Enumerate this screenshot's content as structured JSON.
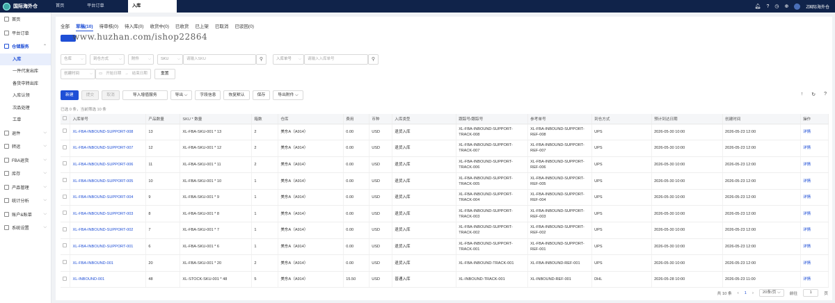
{
  "app": {
    "logo_text": "国际海外仓",
    "username": "Z国际海外仓"
  },
  "top_tabs": [
    "首页",
    "平台订单",
    "入库"
  ],
  "sidebar": {
    "items": [
      {
        "label": "首页",
        "icon": "home-icon",
        "type": "item"
      },
      {
        "label": "平台订单",
        "icon": "order-icon",
        "type": "item"
      },
      {
        "label": "仓储服务",
        "icon": "warehouse-icon",
        "type": "group"
      },
      {
        "label": "入库",
        "type": "sub",
        "active": true
      },
      {
        "label": "一件代发出库",
        "type": "sub"
      },
      {
        "label": "备货中转出库",
        "type": "sub"
      },
      {
        "label": "入库认领",
        "type": "sub"
      },
      {
        "label": "次品处理",
        "type": "sub"
      },
      {
        "label": "工单",
        "type": "sub"
      },
      {
        "label": "退件",
        "icon": "return-icon",
        "type": "item"
      },
      {
        "label": "转运",
        "icon": "transfer-icon",
        "type": "item"
      },
      {
        "label": "FBA退货",
        "icon": "fba-icon",
        "type": "item"
      },
      {
        "label": "库存",
        "icon": "stock-icon",
        "type": "item"
      },
      {
        "label": "产品管理",
        "icon": "product-icon",
        "type": "item"
      },
      {
        "label": "统计分析",
        "icon": "chart-icon",
        "type": "item"
      },
      {
        "label": "账户&账单",
        "icon": "account-icon",
        "type": "item"
      },
      {
        "label": "系统设置",
        "icon": "settings-icon",
        "type": "item"
      }
    ]
  },
  "status_tabs": [
    "全部",
    "草稿(10)",
    "待审核(0)",
    "待入库(0)",
    "收货中(0)",
    "已收货",
    "已上架",
    "已取消",
    "已驳回(0)"
  ],
  "watermark": "www.huzhan.com/ishop22864",
  "filters": {
    "warehouse": "仓库",
    "arrival": "到仓方式",
    "attachment": "附件",
    "sku": "SKU",
    "sku_placeholder": "请输入SKU",
    "inbound_no": "入库单号",
    "inbound_placeholder": "请输入入库单号",
    "create_time": "创建时间",
    "start_date": "开始日期",
    "to": "→",
    "end_date": "结束日期",
    "reset": "重置"
  },
  "toolbar": [
    "新建",
    "提交",
    "取消",
    "导入增值服务",
    "导出",
    "字段信息",
    "恢复默认",
    "保存",
    "导出附件"
  ],
  "selection_info": "已选 0 条，当前筛选 10 条",
  "columns": [
    "入库单号",
    "产品数量",
    "SKU * 数量",
    "箱数",
    "仓库",
    "费用",
    "币种",
    "入库类型",
    "跟踪号/跟踪号",
    "参考单号",
    "到仓方式",
    "预计到达日期",
    "创建时间",
    "操作"
  ],
  "rows": [
    [
      "XL-FBA-INBOUND-SUPPORT-008",
      "13",
      "XL-FBA-SKU-001 * 13",
      "2",
      "美东A（A914）",
      "0.00",
      "USD",
      "退货入库",
      "XL-FBA-INBOUND-SUPPORT-TRACK-008",
      "XL-FBA-INBOUND-SUPPORT-REF-008",
      "UPS",
      "2026-05-30 10:00",
      "2026-05-23 12:00",
      "详情"
    ],
    [
      "XL-FBA-INBOUND-SUPPORT-007",
      "12",
      "XL-FBA-SKU-001 * 12",
      "2",
      "美东A（A914）",
      "0.00",
      "USD",
      "退货入库",
      "XL-FBA-INBOUND-SUPPORT-TRACK-007",
      "XL-FBA-INBOUND-SUPPORT-REF-007",
      "UPS",
      "2026-05-30 10:00",
      "2026-05-23 12:00",
      "详情"
    ],
    [
      "XL-FBA-INBOUND-SUPPORT-006",
      "11",
      "XL-FBA-SKU-001 * 11",
      "2",
      "美东A（A914）",
      "0.00",
      "USD",
      "退货入库",
      "XL-FBA-INBOUND-SUPPORT-TRACK-006",
      "XL-FBA-INBOUND-SUPPORT-REF-006",
      "UPS",
      "2026-05-30 10:00",
      "2026-05-23 12:00",
      "详情"
    ],
    [
      "XL-FBA-INBOUND-SUPPORT-005",
      "10",
      "XL-FBA-SKU-001 * 10",
      "1",
      "美东A（A914）",
      "0.00",
      "USD",
      "退货入库",
      "XL-FBA-INBOUND-SUPPORT-TRACK-005",
      "XL-FBA-INBOUND-SUPPORT-REF-005",
      "UPS",
      "2026-05-30 10:00",
      "2026-05-23 12:00",
      "详情"
    ],
    [
      "XL-FBA-INBOUND-SUPPORT-004",
      "9",
      "XL-FBA-SKU-001 * 9",
      "1",
      "美东A（A914）",
      "0.00",
      "USD",
      "退货入库",
      "XL-FBA-INBOUND-SUPPORT-TRACK-004",
      "XL-FBA-INBOUND-SUPPORT-REF-004",
      "UPS",
      "2026-05-30 10:00",
      "2026-05-23 12:00",
      "详情"
    ],
    [
      "XL-FBA-INBOUND-SUPPORT-003",
      "8",
      "XL-FBA-SKU-001 * 8",
      "1",
      "美东A（A914）",
      "0.00",
      "USD",
      "退货入库",
      "XL-FBA-INBOUND-SUPPORT-TRACK-003",
      "XL-FBA-INBOUND-SUPPORT-REF-003",
      "UPS",
      "2026-05-30 10:00",
      "2026-05-23 12:00",
      "详情"
    ],
    [
      "XL-FBA-INBOUND-SUPPORT-002",
      "7",
      "XL-FBA-SKU-001 * 7",
      "1",
      "美东A（A914）",
      "0.00",
      "USD",
      "退货入库",
      "XL-FBA-INBOUND-SUPPORT-TRACK-002",
      "XL-FBA-INBOUND-SUPPORT-REF-002",
      "UPS",
      "2026-05-30 10:00",
      "2026-05-23 12:00",
      "详情"
    ],
    [
      "XL-FBA-INBOUND-SUPPORT-001",
      "6",
      "XL-FBA-SKU-001 * 6",
      "1",
      "美东A（A914）",
      "0.00",
      "USD",
      "退货入库",
      "XL-FBA-INBOUND-SUPPORT-TRACK-001",
      "XL-FBA-INBOUND-SUPPORT-REF-001",
      "UPS",
      "2026-05-30 10:00",
      "2026-05-23 12:00",
      "详情"
    ],
    [
      "XL-FBA-INBOUND-001",
      "20",
      "XL-FBA-SKU-001 * 20",
      "2",
      "美东A（A914）",
      "0.00",
      "USD",
      "退货入库",
      "XL-FBA-INBOUND-TRACK-001",
      "XL-FBA-INBOUND-REF-001",
      "UPS",
      "2026-05-30 10:00",
      "2026-05-23 12:00",
      "详情"
    ],
    [
      "XL-INBOUND-001",
      "48",
      "XL-STOCK-SKU-001 * 48",
      "5",
      "美东A（A914）",
      "15.50",
      "USD",
      "普通入库",
      "XL-INBOUND-TRACK-001",
      "XL-INBOUND-REF-001",
      "DHL",
      "2026-05-28 10:00",
      "2026-05-23 11:00",
      "详情"
    ]
  ],
  "pager": {
    "total": "共 10 条",
    "current": "1",
    "page_size": "20条/页",
    "goto_label": "前往",
    "goto_value": "1",
    "goto_suffix": "页"
  }
}
